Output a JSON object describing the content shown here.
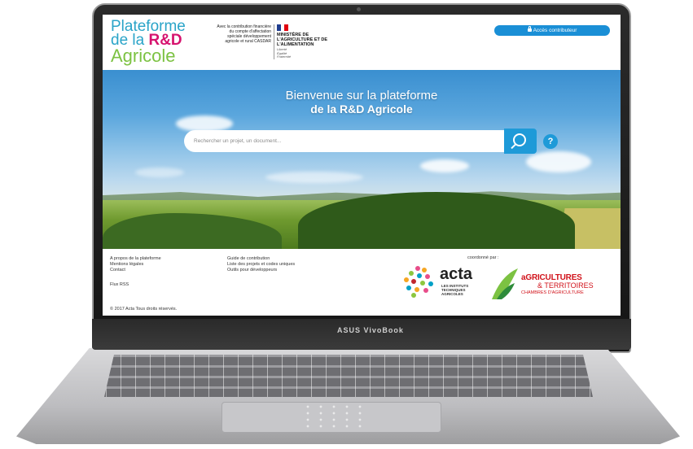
{
  "site": {
    "logo": {
      "line1": "Plateforme",
      "line2_prefix": "de la ",
      "line2_emph": "R&D",
      "line3": "Agricole"
    },
    "contribution_text": "Avec la contribution financière du compte d'affectation spéciale développement agricole et rural CASDAR",
    "ministere": {
      "title": "MINISTÈRE DE L'AGRICULTURE ET DE L'ALIMENTATION",
      "motto": "Liberté Égalité Fraternité"
    },
    "access_button_label": "Accès contributeur"
  },
  "hero": {
    "title_line1": "Bienvenue sur la plateforme",
    "title_line2": "de la R&D Agricole",
    "search_placeholder": "Rechercher un projet, un document...",
    "help_label": "?"
  },
  "footer": {
    "col1": [
      "A propos de la plateforme",
      "Mentions légales",
      "Contact"
    ],
    "col2": [
      "Guide de contribution",
      "Liste des projets et codes uniques",
      "Outils pour développeurs"
    ],
    "rss_label": "Flux RSS",
    "copyright": "© 2017 Acta Tous droits réservés.",
    "coordinated_by": "coordonné par :",
    "acta": {
      "name": "acta",
      "subtitle": [
        "LES INSTITUTS",
        "TECHNIQUES",
        "AGRICOLES"
      ]
    },
    "agri": {
      "line1": "aGRICULTURES",
      "line2": "& TERRITOIRES",
      "line3": "CHAMBRES D'AGRICULTURE"
    }
  },
  "laptop": {
    "brand": "ASUS VivoBook"
  },
  "colors": {
    "accent_blue": "#1e9ad8",
    "logo_blue": "#2aa4c8",
    "logo_pink": "#d6136e",
    "logo_green": "#7cc242",
    "agri_red": "#d1121a",
    "rss_orange": "#f39c12"
  }
}
